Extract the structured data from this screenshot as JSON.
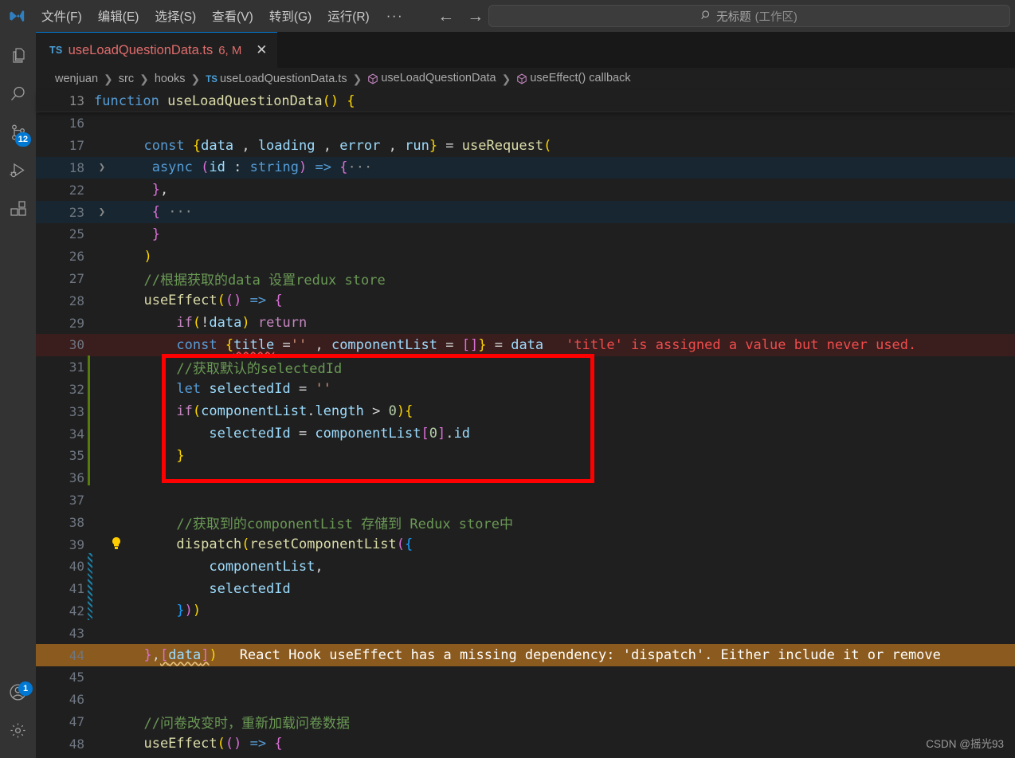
{
  "titlebar": {
    "logo_icon": "vscode-logo-icon",
    "menu": [
      {
        "label": "文件(F)",
        "name": "menu-file"
      },
      {
        "label": "编辑(E)",
        "name": "menu-edit"
      },
      {
        "label": "选择(S)",
        "name": "menu-selection"
      },
      {
        "label": "查看(V)",
        "name": "menu-view"
      },
      {
        "label": "转到(G)",
        "name": "menu-go"
      },
      {
        "label": "运行(R)",
        "name": "menu-run"
      },
      {
        "label": "···",
        "name": "menu-more"
      }
    ],
    "nav_back": "←",
    "nav_forward": "→",
    "command_center": {
      "search_icon": "search-icon",
      "title": "无标题",
      "suffix": "(工作区)"
    }
  },
  "activitybar": {
    "items": [
      {
        "name": "explorer-icon",
        "label": "资源管理器",
        "badge": ""
      },
      {
        "name": "search-icon",
        "label": "搜索",
        "badge": ""
      },
      {
        "name": "source-control-icon",
        "label": "源代码管理",
        "badge": "12"
      },
      {
        "name": "run-debug-icon",
        "label": "运行和调试",
        "badge": ""
      },
      {
        "name": "extensions-icon",
        "label": "扩展",
        "badge": ""
      }
    ],
    "bottom": [
      {
        "name": "account-icon",
        "label": "账户",
        "badge": "1"
      }
    ]
  },
  "tab": {
    "ts_icon": "TS",
    "filename": "useLoadQuestionData.ts",
    "meta": "6, M",
    "close_icon": "✕"
  },
  "breadcrumbs": {
    "segments": [
      {
        "label": "wenjuan",
        "icon": ""
      },
      {
        "label": "src",
        "icon": ""
      },
      {
        "label": "hooks",
        "icon": ""
      },
      {
        "label": "useLoadQuestionData.ts",
        "icon": "ts-file-icon"
      },
      {
        "label": "useLoadQuestionData",
        "icon": "symbol-cube-icon"
      },
      {
        "label": "useEffect() callback",
        "icon": "symbol-cube-icon"
      }
    ],
    "separator": "❯"
  },
  "sticky_scroll": {
    "line_number": "13",
    "tokens": [
      {
        "t": "function",
        "c": "t-kw"
      },
      {
        "t": " ",
        "c": "t-plain"
      },
      {
        "t": "useLoadQuestionData",
        "c": "t-fn"
      },
      {
        "t": "(",
        "c": "t-p1"
      },
      {
        "t": ")",
        "c": "t-p1"
      },
      {
        "t": " ",
        "c": "t-plain"
      },
      {
        "t": "{",
        "c": "t-p1"
      }
    ]
  },
  "editor": {
    "lines": [
      {
        "n": "16",
        "fold": "",
        "hl": "",
        "tokens": []
      },
      {
        "n": "17",
        "fold": "",
        "hl": "",
        "tokens": [
          {
            "t": "  const ",
            "c": "t-kw"
          },
          {
            "t": "{",
            "c": "t-p1"
          },
          {
            "t": "data",
            "c": "t-var"
          },
          {
            "t": " , ",
            "c": "t-plain"
          },
          {
            "t": "loading",
            "c": "t-var"
          },
          {
            "t": " , ",
            "c": "t-plain"
          },
          {
            "t": "error",
            "c": "t-var"
          },
          {
            "t": " , ",
            "c": "t-plain"
          },
          {
            "t": "run",
            "c": "t-var"
          },
          {
            "t": "}",
            "c": "t-p1"
          },
          {
            "t": " = ",
            "c": "t-plain"
          },
          {
            "t": "useRequest",
            "c": "t-fn"
          },
          {
            "t": "(",
            "c": "t-p1"
          }
        ]
      },
      {
        "n": "18",
        "fold": "❯",
        "hl": "line-hl",
        "tokens": [
          {
            "t": "   async ",
            "c": "t-kw"
          },
          {
            "t": "(",
            "c": "t-p2"
          },
          {
            "t": "id",
            "c": "t-var"
          },
          {
            "t": " : ",
            "c": "t-plain"
          },
          {
            "t": "string",
            "c": "t-kw"
          },
          {
            "t": ")",
            "c": "t-p2"
          },
          {
            "t": " ",
            "c": "t-plain"
          },
          {
            "t": "=>",
            "c": "t-kw"
          },
          {
            "t": " ",
            "c": "t-plain"
          },
          {
            "t": "{",
            "c": "t-p2"
          },
          {
            "t": "···",
            "c": "t-dots"
          }
        ]
      },
      {
        "n": "22",
        "fold": "",
        "hl": "",
        "tokens": [
          {
            "t": "   ",
            "c": "t-plain"
          },
          {
            "t": "}",
            "c": "t-p2"
          },
          {
            "t": ",",
            "c": "t-plain"
          }
        ]
      },
      {
        "n": "23",
        "fold": "❯",
        "hl": "line-hl",
        "tokens": [
          {
            "t": "   ",
            "c": "t-plain"
          },
          {
            "t": "{",
            "c": "t-p2"
          },
          {
            "t": " ···",
            "c": "t-dots"
          }
        ]
      },
      {
        "n": "25",
        "fold": "",
        "hl": "",
        "tokens": [
          {
            "t": "   ",
            "c": "t-plain"
          },
          {
            "t": "}",
            "c": "t-p2"
          }
        ]
      },
      {
        "n": "26",
        "fold": "",
        "hl": "",
        "tokens": [
          {
            "t": "  ",
            "c": "t-plain"
          },
          {
            "t": ")",
            "c": "t-p1"
          }
        ]
      },
      {
        "n": "27",
        "fold": "",
        "hl": "",
        "tokens": [
          {
            "t": "  //根据获取的data 设置redux store",
            "c": "t-cmt"
          }
        ]
      },
      {
        "n": "28",
        "fold": "",
        "hl": "",
        "tokens": [
          {
            "t": "  useEffect",
            "c": "t-fn"
          },
          {
            "t": "(",
            "c": "t-p1"
          },
          {
            "t": "(",
            "c": "t-p2"
          },
          {
            "t": ")",
            "c": "t-p2"
          },
          {
            "t": " ",
            "c": "t-plain"
          },
          {
            "t": "=>",
            "c": "t-kw"
          },
          {
            "t": " ",
            "c": "t-plain"
          },
          {
            "t": "{",
            "c": "t-p2"
          }
        ]
      },
      {
        "n": "29",
        "fold": "",
        "hl": "",
        "tokens": [
          {
            "t": "      if",
            "c": "t-kw2"
          },
          {
            "t": "(",
            "c": "t-p1"
          },
          {
            "t": "!",
            "c": "t-plain"
          },
          {
            "t": "data",
            "c": "t-var"
          },
          {
            "t": ")",
            "c": "t-p1"
          },
          {
            "t": " ",
            "c": "t-plain"
          },
          {
            "t": "return",
            "c": "t-kw2"
          }
        ]
      },
      {
        "n": "30",
        "fold": "",
        "hl": "line-err",
        "tokens": [
          {
            "t": "      const ",
            "c": "t-kw"
          },
          {
            "t": "{",
            "c": "t-p1"
          },
          {
            "t": "title",
            "c": "t-var",
            "sq": "squiggle-err"
          },
          {
            "t": " =",
            "c": "t-plain"
          },
          {
            "t": "''",
            "c": "t-str"
          },
          {
            "t": " , ",
            "c": "t-plain"
          },
          {
            "t": "componentList",
            "c": "t-var"
          },
          {
            "t": " = ",
            "c": "t-plain"
          },
          {
            "t": "[",
            "c": "t-p2"
          },
          {
            "t": "]",
            "c": "t-p2"
          },
          {
            "t": "}",
            "c": "t-p1"
          },
          {
            "t": " = ",
            "c": "t-plain"
          },
          {
            "t": "data",
            "c": "t-var"
          }
        ],
        "diag": "'title' is assigned a value but never used.",
        "diag_class": "t-err-msg"
      },
      {
        "n": "31",
        "fold": "",
        "hl": "",
        "tokens": [
          {
            "t": "      //获取默认的selectedId",
            "c": "t-cmt"
          }
        ]
      },
      {
        "n": "32",
        "fold": "",
        "hl": "",
        "tokens": [
          {
            "t": "      let ",
            "c": "t-kw"
          },
          {
            "t": "selectedId",
            "c": "t-var"
          },
          {
            "t": " = ",
            "c": "t-plain"
          },
          {
            "t": "''",
            "c": "t-str"
          }
        ]
      },
      {
        "n": "33",
        "fold": "",
        "hl": "",
        "tokens": [
          {
            "t": "      if",
            "c": "t-kw2"
          },
          {
            "t": "(",
            "c": "t-p1"
          },
          {
            "t": "componentList",
            "c": "t-var"
          },
          {
            "t": ".",
            "c": "t-plain"
          },
          {
            "t": "length",
            "c": "t-prop"
          },
          {
            "t": " > ",
            "c": "t-plain"
          },
          {
            "t": "0",
            "c": "t-num"
          },
          {
            "t": ")",
            "c": "t-p1"
          },
          {
            "t": "{",
            "c": "t-p1"
          }
        ]
      },
      {
        "n": "34",
        "fold": "",
        "hl": "",
        "tokens": [
          {
            "t": "          selectedId",
            "c": "t-var"
          },
          {
            "t": " = ",
            "c": "t-plain"
          },
          {
            "t": "componentList",
            "c": "t-var"
          },
          {
            "t": "[",
            "c": "t-p2"
          },
          {
            "t": "0",
            "c": "t-num"
          },
          {
            "t": "]",
            "c": "t-p2"
          },
          {
            "t": ".",
            "c": "t-plain"
          },
          {
            "t": "id",
            "c": "t-prop"
          }
        ]
      },
      {
        "n": "35",
        "fold": "",
        "hl": "",
        "tokens": [
          {
            "t": "      ",
            "c": "t-plain"
          },
          {
            "t": "}",
            "c": "t-p1"
          }
        ]
      },
      {
        "n": "36",
        "fold": "",
        "hl": "",
        "tokens": []
      },
      {
        "n": "37",
        "fold": "",
        "hl": "",
        "tokens": []
      },
      {
        "n": "38",
        "fold": "",
        "hl": "",
        "tokens": [
          {
            "t": "      //获取到的componentList 存储到 Redux store中",
            "c": "t-cmt"
          }
        ]
      },
      {
        "n": "39",
        "fold": "",
        "hl": "",
        "bulb": true,
        "tokens": [
          {
            "t": "      dispatch",
            "c": "t-fn"
          },
          {
            "t": "(",
            "c": "t-p1"
          },
          {
            "t": "resetComponentList",
            "c": "t-fn"
          },
          {
            "t": "(",
            "c": "t-p2"
          },
          {
            "t": "{",
            "c": "t-p3"
          }
        ]
      },
      {
        "n": "40",
        "fold": "",
        "hl": "",
        "tokens": [
          {
            "t": "          componentList",
            "c": "t-var"
          },
          {
            "t": ",",
            "c": "t-plain"
          }
        ]
      },
      {
        "n": "41",
        "fold": "",
        "hl": "",
        "tokens": [
          {
            "t": "          selectedId",
            "c": "t-var"
          }
        ]
      },
      {
        "n": "42",
        "fold": "",
        "hl": "",
        "tokens": [
          {
            "t": "      ",
            "c": "t-plain"
          },
          {
            "t": "}",
            "c": "t-p3"
          },
          {
            "t": ")",
            "c": "t-p2"
          },
          {
            "t": ")",
            "c": "t-p1"
          }
        ]
      },
      {
        "n": "43",
        "fold": "",
        "hl": "",
        "tokens": []
      },
      {
        "n": "44",
        "fold": "",
        "hl": "line-warn",
        "tokens": [
          {
            "t": "  ",
            "c": "t-plain"
          },
          {
            "t": "}",
            "c": "t-p2"
          },
          {
            "t": ",",
            "c": "t-plain"
          },
          {
            "t": "[",
            "c": "t-p2",
            "sq": "squiggle-warn"
          },
          {
            "t": "data",
            "c": "t-var",
            "sq": "squiggle-warn"
          },
          {
            "t": "]",
            "c": "t-p2",
            "sq": "squiggle-warn"
          },
          {
            "t": ")",
            "c": "t-p1"
          }
        ],
        "diag": "React Hook useEffect has a missing dependency: 'dispatch'. Either include it or remove",
        "diag_class": "t-warn-msg"
      },
      {
        "n": "45",
        "fold": "",
        "hl": "",
        "tokens": []
      },
      {
        "n": "46",
        "fold": "",
        "hl": "",
        "tokens": []
      },
      {
        "n": "47",
        "fold": "",
        "hl": "",
        "tokens": [
          {
            "t": "  //问卷改变时，重新加载问卷数据",
            "c": "t-cmt"
          }
        ]
      },
      {
        "n": "48",
        "fold": "",
        "hl": "",
        "tokens": [
          {
            "t": "  useEffect",
            "c": "t-fn"
          },
          {
            "t": "(",
            "c": "t-p1"
          },
          {
            "t": "(",
            "c": "t-p2"
          },
          {
            "t": ")",
            "c": "t-p2"
          },
          {
            "t": " ",
            "c": "t-plain"
          },
          {
            "t": "=>",
            "c": "t-kw"
          },
          {
            "t": " ",
            "c": "t-plain"
          },
          {
            "t": "{",
            "c": "t-p2"
          }
        ]
      }
    ]
  },
  "annotation": {
    "color": "#ff0000",
    "shape": "rectangle",
    "covers_lines": [
      "31",
      "32",
      "33",
      "34",
      "35",
      "36"
    ]
  },
  "watermark": {
    "text": "CSDN @摇光93"
  },
  "colors": {
    "accent": "#0078d4",
    "titlebar_bg": "#333333",
    "editor_bg": "#1f1f1f",
    "error": "#f14c4c",
    "warning": "#e5c07b",
    "comment": "#6a9955",
    "annotation": "#ff0000",
    "modified_gutter": "#587c0c",
    "staged_gutter": "#1b81a8"
  }
}
